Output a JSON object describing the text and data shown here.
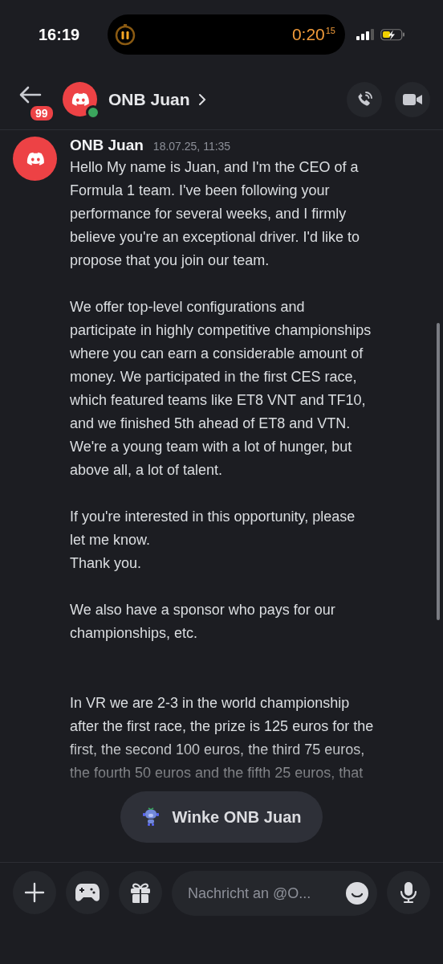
{
  "status_bar": {
    "time": "16:19",
    "timer": {
      "paused": true,
      "elapsed": "0:20",
      "fraction": "15"
    },
    "battery": {
      "charging": true
    }
  },
  "header": {
    "unread_badge": "99",
    "contact": {
      "name": "ONB Juan",
      "online": true
    }
  },
  "messages": [
    {
      "author": "ONB Juan",
      "timestamp": "18.07.25, 11:35",
      "text": "Hello My name is Juan, and I'm the CEO of a\nFormula 1 team. I've been following your\nperformance for several weeks, and I firmly\nbelieve you're an exceptional driver. I'd like to\npropose that you join our team.\n\nWe offer top-level configurations and\nparticipate in highly competitive championships\nwhere you can earn a considerable amount of\nmoney. We participated in the first CES race,\nwhich featured teams like ET8 VNT and TF10,\nand we finished 5th ahead of ET8 and VTN.\nWe're a young team with a lot of hunger, but\nabove all, a lot of talent.\n\nIf you're interested in this opportunity, please\nlet me know.\nThank you.\n\nWe also have a sponsor who pays for our\nchampionships, etc.\n\n\nIn VR we are 2-3 in the world championship\nafter the first race, the prize is 125 euros for the\nfirst, the second 100 euros, the third 75 euros,\nthe fourth 50 euros and the fifth 25 euros, that"
    }
  ],
  "wave_button": {
    "label": "Winke ONB Juan"
  },
  "composer": {
    "placeholder": "Nachricht an @O..."
  }
}
